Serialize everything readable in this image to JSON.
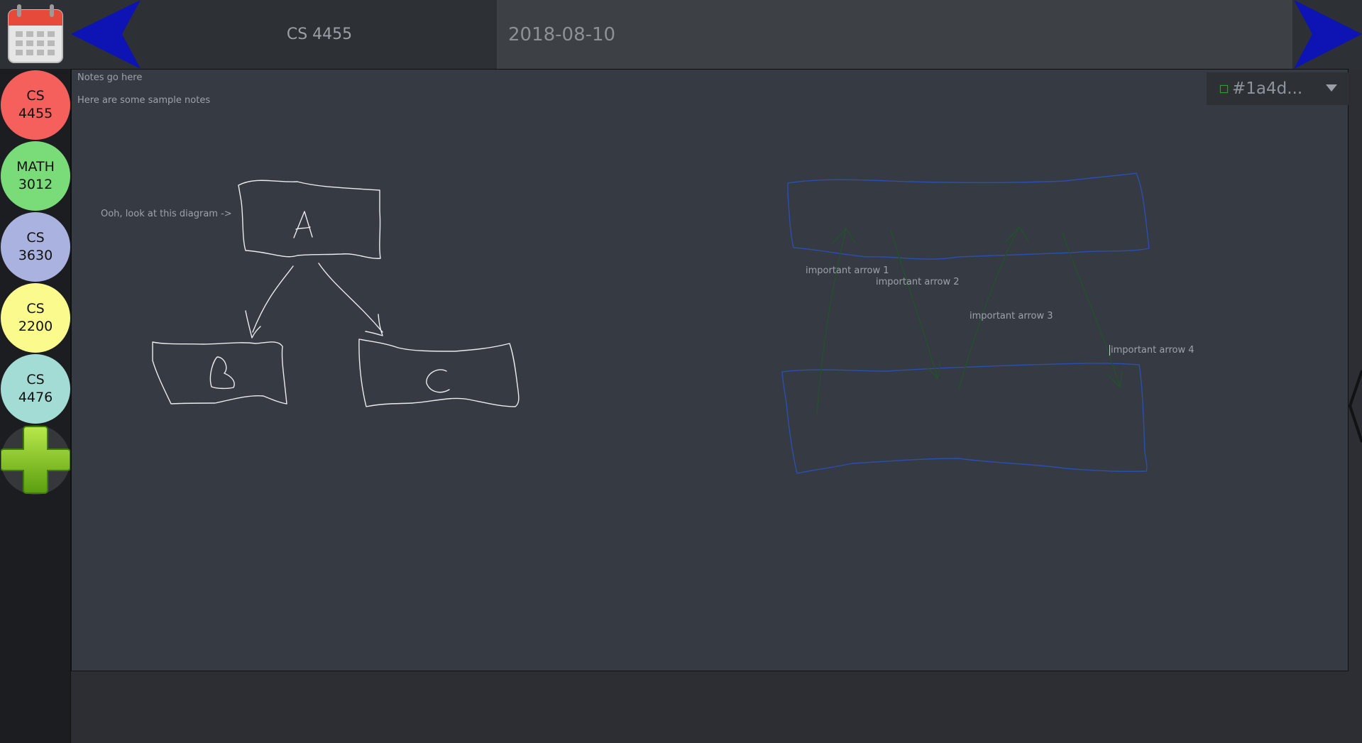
{
  "header": {
    "calendar_icon": "calendar-icon",
    "prev_icon": "arrow-left-icon",
    "next_icon": "arrow-right-icon",
    "course_title": "CS 4455",
    "date": "2018-08-10"
  },
  "sidebar": {
    "courses": [
      {
        "line1": "CS",
        "line2": "4455",
        "color": "#f55f5c"
      },
      {
        "line1": "MATH",
        "line2": "3012",
        "color": "#79dc79"
      },
      {
        "line1": "CS",
        "line2": "3630",
        "color": "#aab3e0"
      },
      {
        "line1": "CS",
        "line2": "2200",
        "color": "#fbfa8c"
      },
      {
        "line1": "CS",
        "line2": "4476",
        "color": "#a3dcd4"
      }
    ],
    "add_icon": "plus-icon"
  },
  "notes": {
    "line1": "Notes go here",
    "line2": "Here are some sample notes",
    "diagram_caption": "Ooh, look at this diagram ->",
    "arrow_labels": [
      "important arrow 1",
      "important arrow 2",
      "important arrow 3",
      "important arrow 4"
    ]
  },
  "color_picker": {
    "value": "#1a4d...",
    "swatch_color": "#2f9c2f"
  },
  "colors": {
    "pen_white": "#e9ecef",
    "pen_blue": "#2b4fb0",
    "pen_green": "#24502e",
    "nav_blue": "#0d14b3"
  }
}
